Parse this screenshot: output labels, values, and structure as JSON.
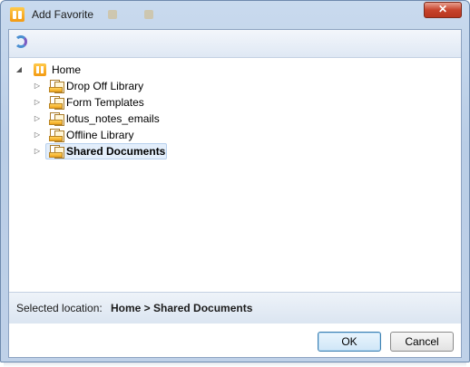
{
  "window": {
    "title": "Add Favorite",
    "close_glyph": "✕"
  },
  "toolbar": {
    "refresh_icon": "refresh-icon"
  },
  "tree": {
    "root": {
      "label": "Home",
      "expanded": true,
      "expander": "◢",
      "icon": "home-icon"
    },
    "children": [
      {
        "label": "Drop Off Library",
        "expander": "▷",
        "icon": "library-icon",
        "selected": false
      },
      {
        "label": "Form Templates",
        "expander": "▷",
        "icon": "library-icon",
        "selected": false
      },
      {
        "label": "lotus_notes_emails",
        "expander": "▷",
        "icon": "library-icon",
        "selected": false
      },
      {
        "label": "Offline Library",
        "expander": "▷",
        "icon": "library-icon",
        "selected": false
      },
      {
        "label": "Shared Documents",
        "expander": "▷",
        "icon": "library-icon",
        "selected": true
      }
    ]
  },
  "status": {
    "label": "Selected location:",
    "value": "Home > Shared Documents"
  },
  "buttons": {
    "ok": "OK",
    "cancel": "Cancel"
  }
}
